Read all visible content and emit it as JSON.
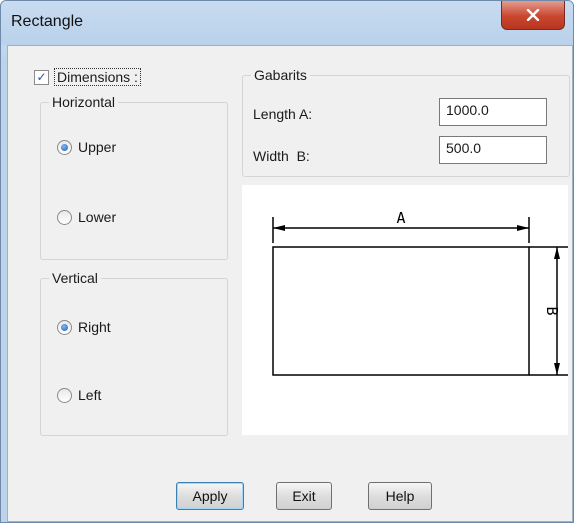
{
  "window": {
    "title": "Rectangle",
    "close_label": "X"
  },
  "dimensions": {
    "label": "Dimensions :",
    "checked": true
  },
  "horizontal": {
    "label": "Horizontal",
    "options": [
      "Upper",
      "Lower"
    ],
    "selected": "Upper"
  },
  "vertical": {
    "label": "Vertical",
    "options": [
      "Right",
      "Left"
    ],
    "selected": "Right"
  },
  "gabarits": {
    "label": "Gabarits",
    "length_label": "Length A:",
    "length_value": "1000.0",
    "width_label": "Width  B:",
    "width_value": "500.0"
  },
  "preview": {
    "label_a": "A",
    "label_b": "B"
  },
  "buttons": {
    "apply": "Apply",
    "exit": "Exit",
    "help": "Help"
  }
}
